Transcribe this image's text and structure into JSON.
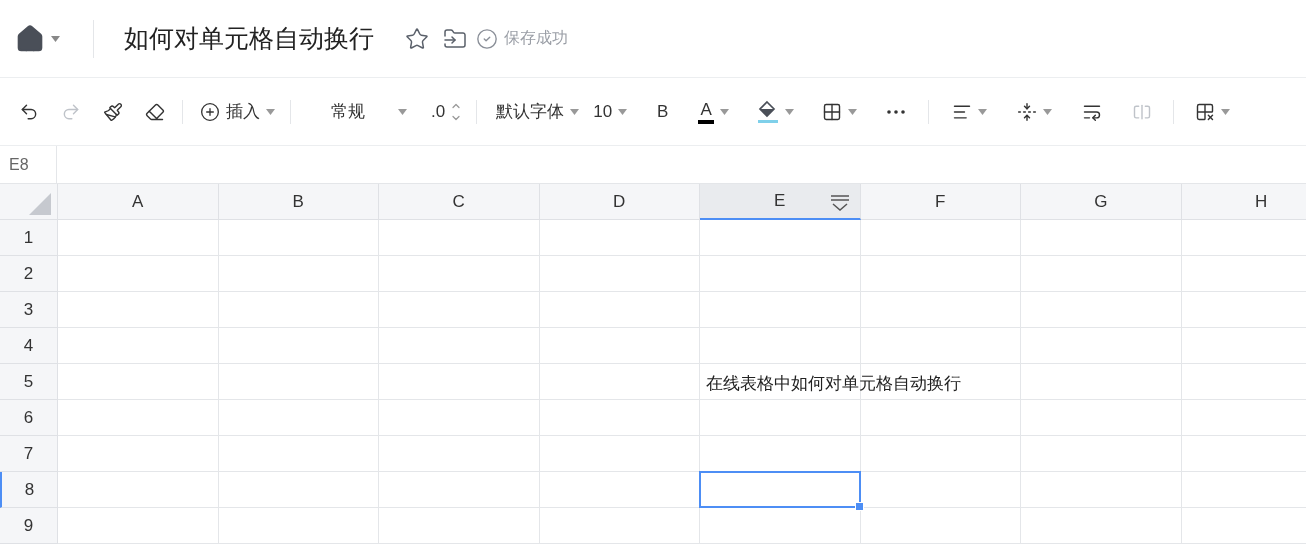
{
  "header": {
    "title": "如何对单元格自动换行",
    "status": "保存成功"
  },
  "toolbar": {
    "insert_label": "插入",
    "number_format": "常规",
    "decimal": ".0",
    "font": "默认字体",
    "font_size": "10",
    "bold": "B",
    "font_color": "A",
    "redo_disabled": true,
    "merge_disabled": true
  },
  "name_box": "E8",
  "columns": [
    {
      "label": "A",
      "selected": false
    },
    {
      "label": "B",
      "selected": false
    },
    {
      "label": "C",
      "selected": false
    },
    {
      "label": "D",
      "selected": false
    },
    {
      "label": "E",
      "selected": true
    },
    {
      "label": "F",
      "selected": false
    },
    {
      "label": "G",
      "selected": false
    },
    {
      "label": "H",
      "selected": false
    }
  ],
  "rows": [
    {
      "label": "1",
      "selected": false
    },
    {
      "label": "2",
      "selected": false
    },
    {
      "label": "3",
      "selected": false
    },
    {
      "label": "4",
      "selected": false
    },
    {
      "label": "5",
      "selected": false,
      "cells": [
        null,
        null,
        null,
        null,
        "在线表格中如何对单元格自动换行"
      ]
    },
    {
      "label": "6",
      "selected": false
    },
    {
      "label": "7",
      "selected": false
    },
    {
      "label": "8",
      "selected": true
    },
    {
      "label": "9",
      "selected": false
    }
  ]
}
